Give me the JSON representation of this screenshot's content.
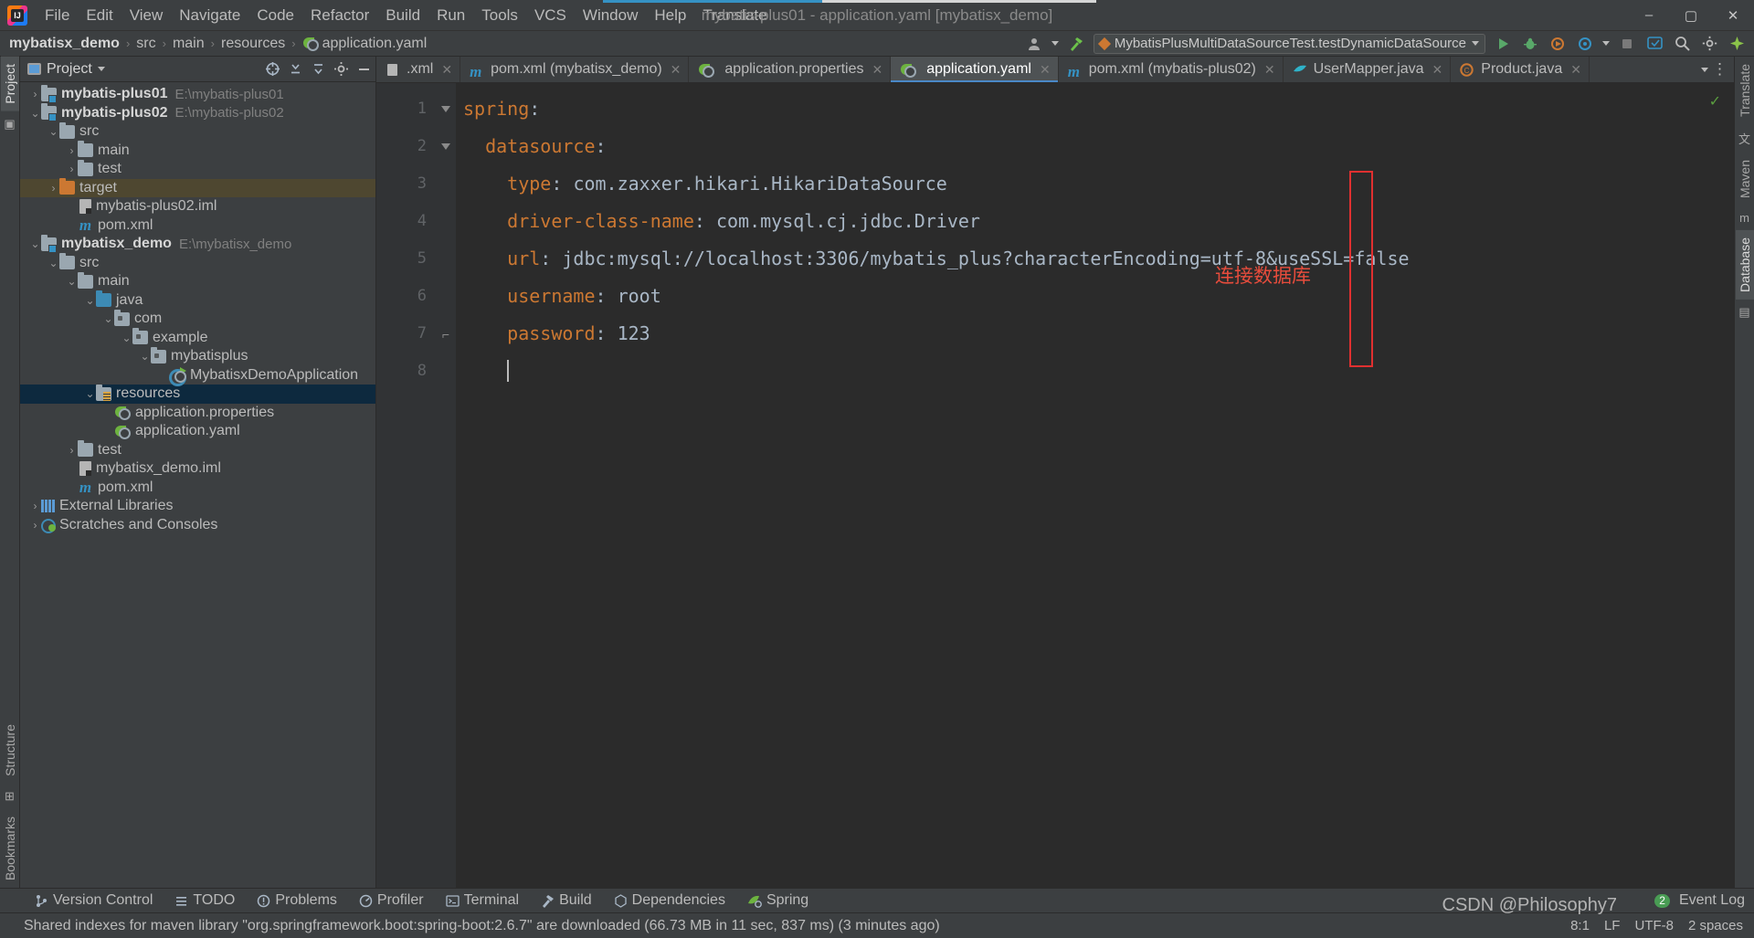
{
  "window": {
    "title": "mybatis-plus01 - application.yaml [mybatisx_demo]",
    "app_icon": "intellij-idea-logo",
    "minimize": "–",
    "maximize": "▢",
    "close": "✕"
  },
  "menu": [
    {
      "label": "File"
    },
    {
      "label": "Edit"
    },
    {
      "label": "View"
    },
    {
      "label": "Navigate"
    },
    {
      "label": "Code"
    },
    {
      "label": "Refactor"
    },
    {
      "label": "Build"
    },
    {
      "label": "Run"
    },
    {
      "label": "Tools"
    },
    {
      "label": "VCS"
    },
    {
      "label": "Window"
    },
    {
      "label": "Help"
    },
    {
      "label": "Translate"
    }
  ],
  "breadcrumb": [
    {
      "label": "mybatisx_demo"
    },
    {
      "label": "src"
    },
    {
      "label": "main"
    },
    {
      "label": "resources"
    },
    {
      "label": "application.yaml"
    }
  ],
  "toolbar": {
    "run_config": "MybatisPlusMultiDataSourceTest.testDynamicDataSource",
    "icons": [
      "user-icon",
      "hammer-build-icon",
      "run-icon",
      "debug-icon",
      "run-coverage-icon",
      "profiler-icon",
      "stop-icon",
      "updates-icon",
      "search-icon",
      "settings-gear-icon",
      "idea-assistant-icon"
    ]
  },
  "project_panel": {
    "title": "Project",
    "header_icons": [
      "scope-icon",
      "collapse-all-icon",
      "expand-all-icon",
      "settings-gear-icon",
      "hide-icon"
    ],
    "tree": [
      {
        "label": "mybatis-plus01",
        "path": "E:\\mybatis-plus01",
        "indent": 0,
        "arrow": "collapsed",
        "icon": "module",
        "bold": true
      },
      {
        "label": "mybatis-plus02",
        "path": "E:\\mybatis-plus02",
        "indent": 0,
        "arrow": "expanded",
        "icon": "module",
        "bold": true
      },
      {
        "label": "src",
        "path": "",
        "indent": 1,
        "arrow": "expanded",
        "icon": "folder",
        "bold": false
      },
      {
        "label": "main",
        "path": "",
        "indent": 2,
        "arrow": "collapsed",
        "icon": "folder",
        "bold": false
      },
      {
        "label": "test",
        "path": "",
        "indent": 2,
        "arrow": "collapsed",
        "icon": "folder",
        "bold": false
      },
      {
        "label": "target",
        "path": "",
        "indent": 1,
        "arrow": "collapsed",
        "icon": "folder-orange",
        "bold": false,
        "highlight": "olive"
      },
      {
        "label": "mybatis-plus02.iml",
        "path": "",
        "indent": 2,
        "arrow": "none",
        "icon": "iml",
        "bold": false
      },
      {
        "label": "pom.xml",
        "path": "",
        "indent": 2,
        "arrow": "none",
        "icon": "maven",
        "bold": false
      },
      {
        "label": "mybatisx_demo",
        "path": "E:\\mybatisx_demo",
        "indent": 0,
        "arrow": "expanded",
        "icon": "module",
        "bold": true
      },
      {
        "label": "src",
        "path": "",
        "indent": 1,
        "arrow": "expanded",
        "icon": "folder",
        "bold": false
      },
      {
        "label": "main",
        "path": "",
        "indent": 2,
        "arrow": "expanded",
        "icon": "folder",
        "bold": false
      },
      {
        "label": "java",
        "path": "",
        "indent": 3,
        "arrow": "expanded",
        "icon": "folder-blue",
        "bold": false
      },
      {
        "label": "com",
        "path": "",
        "indent": 4,
        "arrow": "expanded",
        "icon": "package",
        "bold": false
      },
      {
        "label": "example",
        "path": "",
        "indent": 5,
        "arrow": "expanded",
        "icon": "package",
        "bold": false
      },
      {
        "label": "mybatisplus",
        "path": "",
        "indent": 6,
        "arrow": "expanded",
        "icon": "package",
        "bold": false
      },
      {
        "label": "MybatisxDemoApplication",
        "path": "",
        "indent": 7,
        "arrow": "none",
        "icon": "springboot-class",
        "bold": false
      },
      {
        "label": "resources",
        "path": "",
        "indent": 3,
        "arrow": "expanded",
        "icon": "resource-root",
        "bold": false,
        "highlight": "blue"
      },
      {
        "label": "application.properties",
        "path": "",
        "indent": 4,
        "arrow": "none",
        "icon": "spring-leaf",
        "bold": false
      },
      {
        "label": "application.yaml",
        "path": "",
        "indent": 4,
        "arrow": "none",
        "icon": "spring-leaf",
        "bold": false
      },
      {
        "label": "test",
        "path": "",
        "indent": 2,
        "arrow": "collapsed",
        "icon": "folder",
        "bold": false
      },
      {
        "label": "mybatisx_demo.iml",
        "path": "",
        "indent": 2,
        "arrow": "none",
        "icon": "iml",
        "bold": false
      },
      {
        "label": "pom.xml",
        "path": "",
        "indent": 2,
        "arrow": "none",
        "icon": "maven",
        "bold": false
      },
      {
        "label": "External Libraries",
        "path": "",
        "indent": 0,
        "arrow": "collapsed",
        "icon": "libraries",
        "bold": false
      },
      {
        "label": "Scratches and Consoles",
        "path": "",
        "indent": 0,
        "arrow": "collapsed",
        "icon": "scratches",
        "bold": false
      }
    ]
  },
  "editor_tabs": [
    {
      "label": ".xml",
      "icon": "xml-icon",
      "active": false
    },
    {
      "label": "pom.xml (mybatisx_demo)",
      "icon": "maven-icon",
      "active": false
    },
    {
      "label": "application.properties",
      "icon": "spring-leaf-icon",
      "active": false
    },
    {
      "label": "application.yaml",
      "icon": "spring-leaf-icon",
      "active": true
    },
    {
      "label": "pom.xml (mybatis-plus02)",
      "icon": "maven-icon",
      "active": false
    },
    {
      "label": "UserMapper.java",
      "icon": "mybatis-icon",
      "active": false
    },
    {
      "label": "Product.java",
      "icon": "java-class-icon",
      "active": false
    }
  ],
  "editor": {
    "line_numbers": [
      "1",
      "2",
      "3",
      "4",
      "5",
      "6",
      "7",
      "8"
    ],
    "lines": [
      {
        "num": "1",
        "indent": 0,
        "key": "spring",
        "value": "",
        "fold": "expanded-top"
      },
      {
        "num": "2",
        "indent": 2,
        "key": "datasource",
        "value": "",
        "fold": "expanded"
      },
      {
        "num": "3",
        "indent": 4,
        "key": "type",
        "value": "com.zaxxer.hikari.HikariDataSource",
        "fold": "none"
      },
      {
        "num": "4",
        "indent": 4,
        "key": "driver-class-name",
        "value": "com.mysql.cj.jdbc.Driver",
        "fold": "none"
      },
      {
        "num": "5",
        "indent": 4,
        "key": "url",
        "value": "jdbc:mysql://localhost:3306/mybatis_plus?characterEncoding=utf-8&useSSL=false",
        "fold": "none"
      },
      {
        "num": "6",
        "indent": 4,
        "key": "username",
        "value": "root",
        "fold": "none"
      },
      {
        "num": "7",
        "indent": 4,
        "key": "password",
        "value": "123",
        "fold": "end"
      },
      {
        "num": "8",
        "indent": 4,
        "key": "",
        "value": "",
        "fold": "none"
      }
    ],
    "annotation": "连接数据库",
    "annotation_color": "#e74c3c",
    "inspection_status": "✓"
  },
  "right_strip": {
    "tabs": [
      {
        "label": "Translate"
      },
      {
        "label": "Maven"
      },
      {
        "label": "Database",
        "selected": true
      }
    ]
  },
  "left_strip": {
    "tabs": [
      {
        "label": "Project",
        "selected": true
      },
      {
        "label": "Structure"
      },
      {
        "label": "Bookmarks"
      }
    ]
  },
  "bottom_bar": {
    "items": [
      {
        "label": "Version Control",
        "icon": "branch-icon"
      },
      {
        "label": "TODO",
        "icon": "list-icon"
      },
      {
        "label": "Problems",
        "icon": "warning-icon"
      },
      {
        "label": "Profiler",
        "icon": "profiler-icon"
      },
      {
        "label": "Terminal",
        "icon": "terminal-icon"
      },
      {
        "label": "Build",
        "icon": "hammer-icon"
      },
      {
        "label": "Dependencies",
        "icon": "dependencies-icon"
      },
      {
        "label": "Spring",
        "icon": "spring-leaf-icon"
      }
    ],
    "event_log": "Event Log",
    "event_log_count": "2"
  },
  "status_bar": {
    "message": "Shared indexes for maven library \"org.springframework.boot:spring-boot:2.6.7\" are downloaded (66.73 MB in 11 sec, 837 ms) (3 minutes ago)",
    "caret": "8:1",
    "line_sep": "LF",
    "encoding": "UTF-8",
    "indent": "2 spaces",
    "watermark": "CSDN @Philosophy7"
  },
  "colors": {
    "accent_blue": "#4a88c7",
    "key_orange": "#cc7832",
    "value_grey": "#a9b7c6",
    "selection_blue": "#0d293e",
    "selection_olive": "#4e4730",
    "annotation_red": "#e74c3c",
    "editor_bg": "#2b2b2b",
    "panel_bg": "#3c3f41"
  }
}
